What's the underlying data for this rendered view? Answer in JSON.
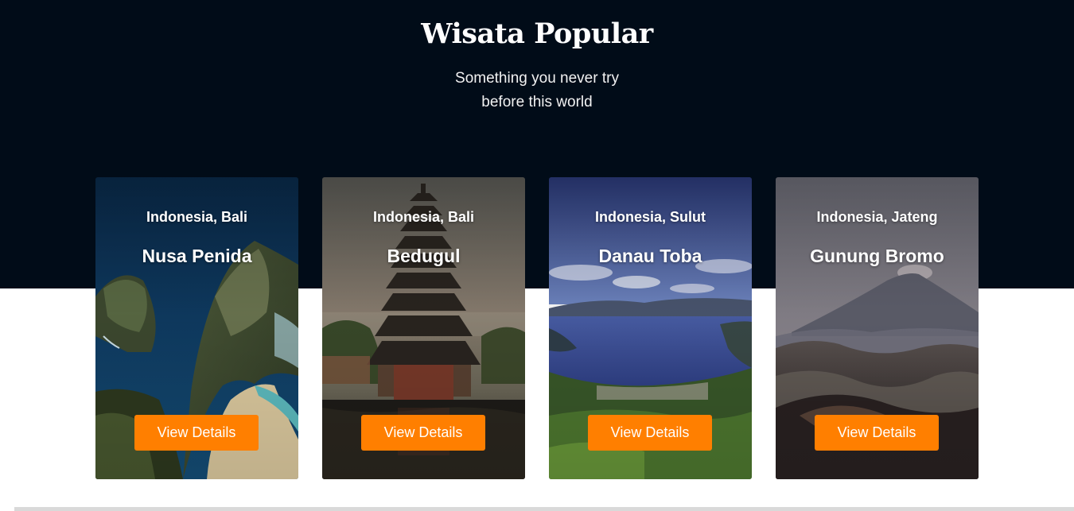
{
  "section": {
    "title": "Wisata Popular",
    "subtitle_line1": "Something you never try",
    "subtitle_line2": "before this world"
  },
  "cards": [
    {
      "location": "Indonesia, Bali",
      "name": "Nusa Penida",
      "button_label": "View Details"
    },
    {
      "location": "Indonesia, Bali",
      "name": "Bedugul",
      "button_label": "View Details"
    },
    {
      "location": "Indonesia, Sulut",
      "name": "Danau Toba",
      "button_label": "View Details"
    },
    {
      "location": "Indonesia, Jateng",
      "name": "Gunung Bromo",
      "button_label": "View Details"
    }
  ],
  "colors": {
    "hero_background": "#010c18",
    "button_accent": "#ff7f00",
    "page_background": "#ffffff"
  }
}
